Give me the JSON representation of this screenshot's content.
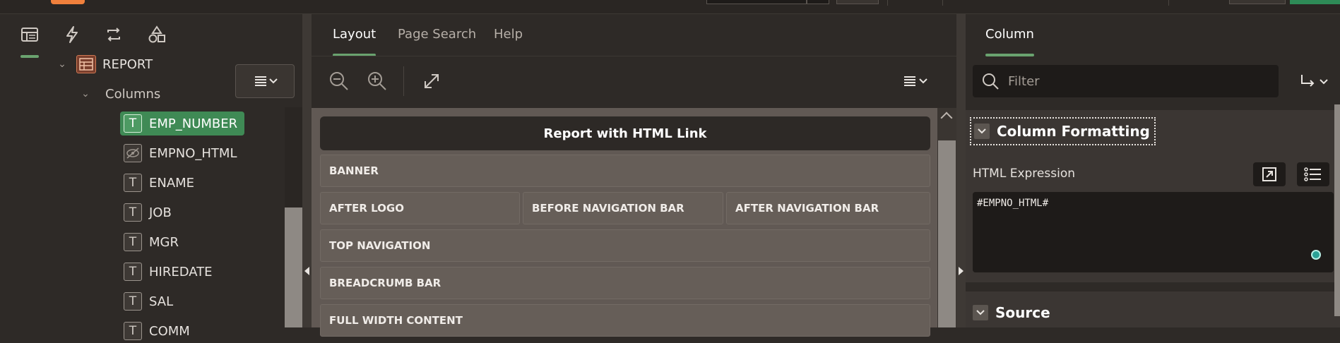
{
  "left_panel": {
    "tabs": [
      {
        "icon": "rendering-tree-icon"
      },
      {
        "icon": "dynamic-actions-icon"
      },
      {
        "icon": "processing-icon"
      },
      {
        "icon": "shared-components-icon"
      }
    ],
    "tree": {
      "report_label": "REPORT",
      "columns_label": "Columns",
      "items": [
        {
          "label": "EMP_NUMBER",
          "icon": "text-column-icon",
          "selected": true
        },
        {
          "label": "EMPNO_HTML",
          "icon": "hidden-column-icon",
          "selected": false
        },
        {
          "label": "ENAME",
          "icon": "text-column-icon",
          "selected": false
        },
        {
          "label": "JOB",
          "icon": "text-column-icon",
          "selected": false
        },
        {
          "label": "MGR",
          "icon": "text-column-icon",
          "selected": false
        },
        {
          "label": "HIREDATE",
          "icon": "text-column-icon",
          "selected": false
        },
        {
          "label": "SAL",
          "icon": "text-column-icon",
          "selected": false
        },
        {
          "label": "COMM",
          "icon": "text-column-icon",
          "selected": false
        }
      ]
    }
  },
  "middle_panel": {
    "tabs": [
      "Layout",
      "Page Search",
      "Help"
    ],
    "active_tab": "Layout",
    "region_title": "Report with HTML Link",
    "regions": {
      "banner": "BANNER",
      "after_logo": "AFTER LOGO",
      "before_nav": "BEFORE NAVIGATION BAR",
      "after_nav": "AFTER NAVIGATION BAR",
      "top_nav": "TOP NAVIGATION",
      "breadcrumb": "BREADCRUMB BAR",
      "full_width": "FULL WIDTH CONTENT"
    }
  },
  "right_panel": {
    "tab": "Column",
    "filter_placeholder": "Filter",
    "section_formatting": "Column Formatting",
    "html_expression_label": "HTML Expression",
    "html_expression_value": "#EMPNO_HTML#",
    "section_source": "Source"
  },
  "colors": {
    "accent_green": "#6aa36f",
    "selected_bg": "#3f8a55",
    "canvas_bg": "#615954",
    "panel_bg": "#2e2a27"
  }
}
